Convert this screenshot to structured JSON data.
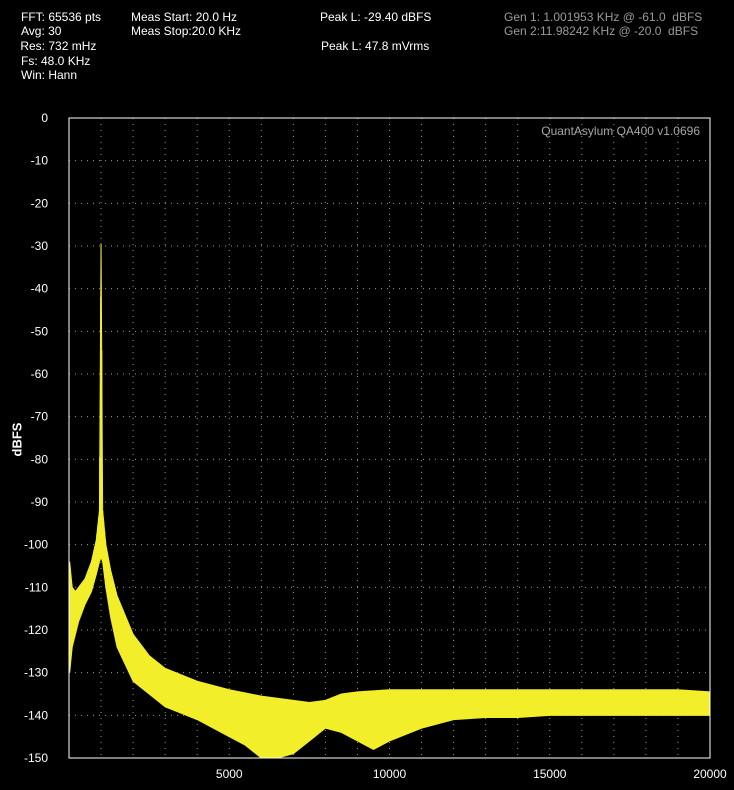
{
  "header": {
    "fft": "FFT: 65536 pts",
    "avg": "Avg: 30",
    "res": " Res: 732 mHz",
    "fs": "Fs: 48.0 KHz",
    "win": "Win: Hann",
    "meas_start": "Meas Start: 20.0 Hz",
    "meas_stop": "Meas Stop:20.0 KHz",
    "peak_dbfs": "Peak L: -29.40 dBFS",
    "peak_vrms": "Peak L: 47.8 mVrms",
    "gen1": "Gen 1: 1.001953 KHz @ -61.0  dBFS",
    "gen2": "Gen 2:11.98242 KHz @ -20.0  dBFS"
  },
  "colors": {
    "trace": "#f2ee2a",
    "grid": "#9a9a9a",
    "axis": "#ffffff",
    "watermark": "#a8a8a8"
  },
  "chart_data": {
    "type": "line",
    "title": "",
    "watermark": "QuantAsylum QA400 v1.0696",
    "xlabel": "",
    "ylabel": "dBFS",
    "xlim": [
      0,
      20000
    ],
    "ylim": [
      -150,
      0
    ],
    "x_ticks": [
      5000,
      10000,
      15000,
      20000
    ],
    "y_ticks": [
      0,
      -10,
      -20,
      -30,
      -40,
      -50,
      -60,
      -70,
      -80,
      -90,
      -100,
      -110,
      -120,
      -130,
      -140,
      -150
    ],
    "grid": true,
    "series": [
      {
        "upper": {
          "x": [
            20,
            100,
            200,
            300,
            500,
            700,
            850,
            950,
            1000,
            1050,
            1150,
            1300,
            1500,
            2000,
            2500,
            3000,
            4000,
            5000,
            6000,
            7000,
            7500,
            8000,
            8500,
            9000,
            10000,
            11000,
            12000,
            13000,
            14000,
            15000,
            16000,
            17000,
            18000,
            19000,
            20000
          ],
          "y": [
            -104,
            -110,
            -111,
            -110,
            -108,
            -104,
            -99,
            -92,
            -29.4,
            -92,
            -100,
            -106,
            -112,
            -121,
            -126,
            -129,
            -132,
            -134,
            -135.5,
            -136.5,
            -137,
            -136.5,
            -135,
            -134.5,
            -134,
            -134,
            -134,
            -134,
            -134,
            -134,
            -134,
            -134,
            -134,
            -134,
            -134.5
          ]
        },
        "lower": {
          "x": [
            20,
            100,
            200,
            300,
            500,
            700,
            850,
            950,
            1000,
            1050,
            1150,
            1300,
            1500,
            2000,
            2500,
            3000,
            4000,
            5000,
            5500,
            6000,
            6500,
            7000,
            7500,
            8000,
            8500,
            9000,
            9500,
            10000,
            11000,
            12000,
            13000,
            14000,
            15000,
            16000,
            17000,
            18000,
            19000,
            20000
          ],
          "y": [
            -130,
            -124,
            -121,
            -118,
            -114,
            -111,
            -107,
            -104,
            -103,
            -104,
            -110,
            -117,
            -124,
            -132,
            -135,
            -138,
            -141,
            -145,
            -147,
            -150,
            -150,
            -149,
            -146,
            -143,
            -144,
            -146,
            -148,
            -146,
            -143,
            -141,
            -140.5,
            -140.5,
            -140,
            -140,
            -140,
            -140,
            -140,
            -140
          ]
        }
      }
    ]
  }
}
